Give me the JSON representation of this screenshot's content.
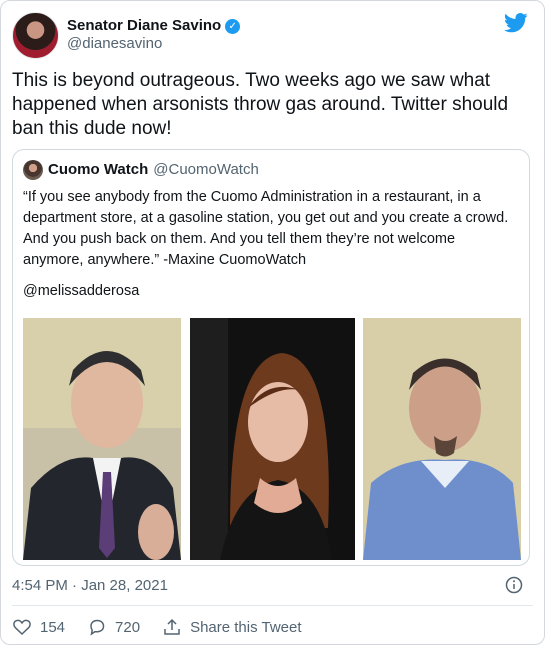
{
  "author": {
    "display_name": "Senator Diane Savino",
    "handle": "@dianesavino",
    "verified_icon": "verified-badge-icon",
    "avatar_icon": "profile-avatar"
  },
  "platform_icon": "twitter-bird-icon",
  "tweet": {
    "text": "This is beyond outrageous.  Two weeks ago we saw what happened when arsonists throw gas around.  Twitter should ban this dude now!"
  },
  "quoted_tweet": {
    "display_name": "Cuomo Watch",
    "handle": "@CuomoWatch",
    "text": "“If you see anybody from the Cuomo Administration in a restaurant, in a department store, at a gasoline station, you get out and you create a crowd. And you push back on them. And you tell them they’re not welcome anymore, anywhere.” -Maxine CuomoWatch",
    "mention": "@melissadderosa",
    "photos": [
      "man-in-suit-photo",
      "woman-portrait-photo",
      "man-blue-shirt-photo"
    ]
  },
  "meta": {
    "timestamp": "4:54 PM · Jan 28, 2021",
    "info_icon": "info-icon"
  },
  "actions": {
    "like_count": "154",
    "reply_count": "720",
    "share_label": "Share this Tweet"
  },
  "colors": {
    "accent": "#1d9bf0",
    "secondary_text": "#536471",
    "border": "#cfd9de"
  }
}
